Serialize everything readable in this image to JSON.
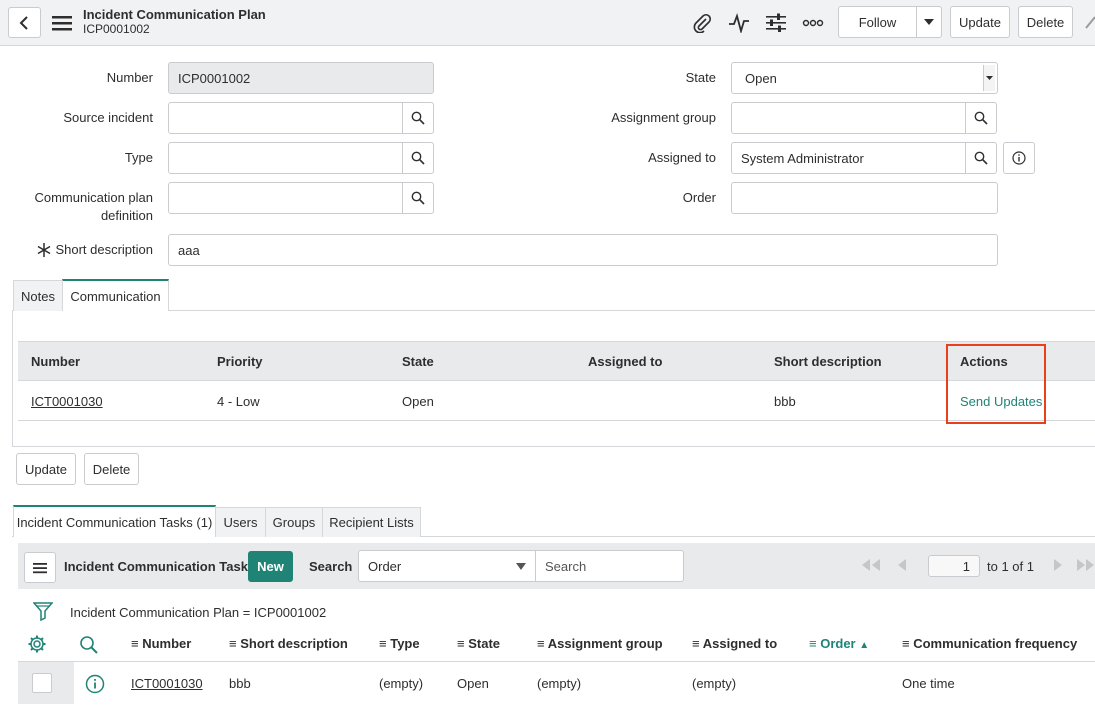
{
  "header": {
    "title": "Incident Communication Plan",
    "record_id": "ICP0001002",
    "follow_label": "Follow",
    "update_label": "Update",
    "delete_label": "Delete"
  },
  "form": {
    "number_label": "Number",
    "number_value": "ICP0001002",
    "source_incident_label": "Source incident",
    "type_label": "Type",
    "comm_plan_def_label_line1": "Communication plan",
    "comm_plan_def_label_line2": "definition",
    "short_description_label": "Short description",
    "short_description_value": "aaa",
    "state_label": "State",
    "state_value": "Open",
    "assignment_group_label": "Assignment group",
    "assigned_to_label": "Assigned to",
    "assigned_to_value": "System Administrator",
    "order_label": "Order"
  },
  "section_tabs": [
    "Notes",
    "Communication"
  ],
  "comm_table": {
    "headers": [
      "Number",
      "Priority",
      "State",
      "Assigned to",
      "Short description",
      "Actions"
    ],
    "row": {
      "number": "ICT0001030",
      "priority": "4 - Low",
      "state": "Open",
      "assigned_to": "",
      "short_description": "bbb",
      "action": "Send Updates"
    }
  },
  "form_buttons": {
    "update": "Update",
    "delete": "Delete"
  },
  "related_tabs": [
    "Incident Communication Tasks (1)",
    "Users",
    "Groups",
    "Recipient Lists"
  ],
  "related_list": {
    "title": "Incident Communication Tasks",
    "new_label": "New",
    "search_label": "Search",
    "search_field": "Order",
    "search_placeholder": "Search",
    "page_value": "1",
    "page_range": "to 1 of 1",
    "filter_text": "Incident Communication Plan = ICP0001002",
    "columns": [
      "Number",
      "Short description",
      "Type",
      "State",
      "Assignment group",
      "Assigned to",
      "Order",
      "Communication frequency"
    ],
    "row": {
      "number": "ICT0001030",
      "short_description": "bbb",
      "type": "(empty)",
      "state": "Open",
      "assignment_group": "(empty)",
      "assigned_to": "(empty)",
      "order": "",
      "communication_frequency": "One time"
    }
  },
  "colors": {
    "accent": "#1f8476",
    "highlight": "#e8401c"
  }
}
